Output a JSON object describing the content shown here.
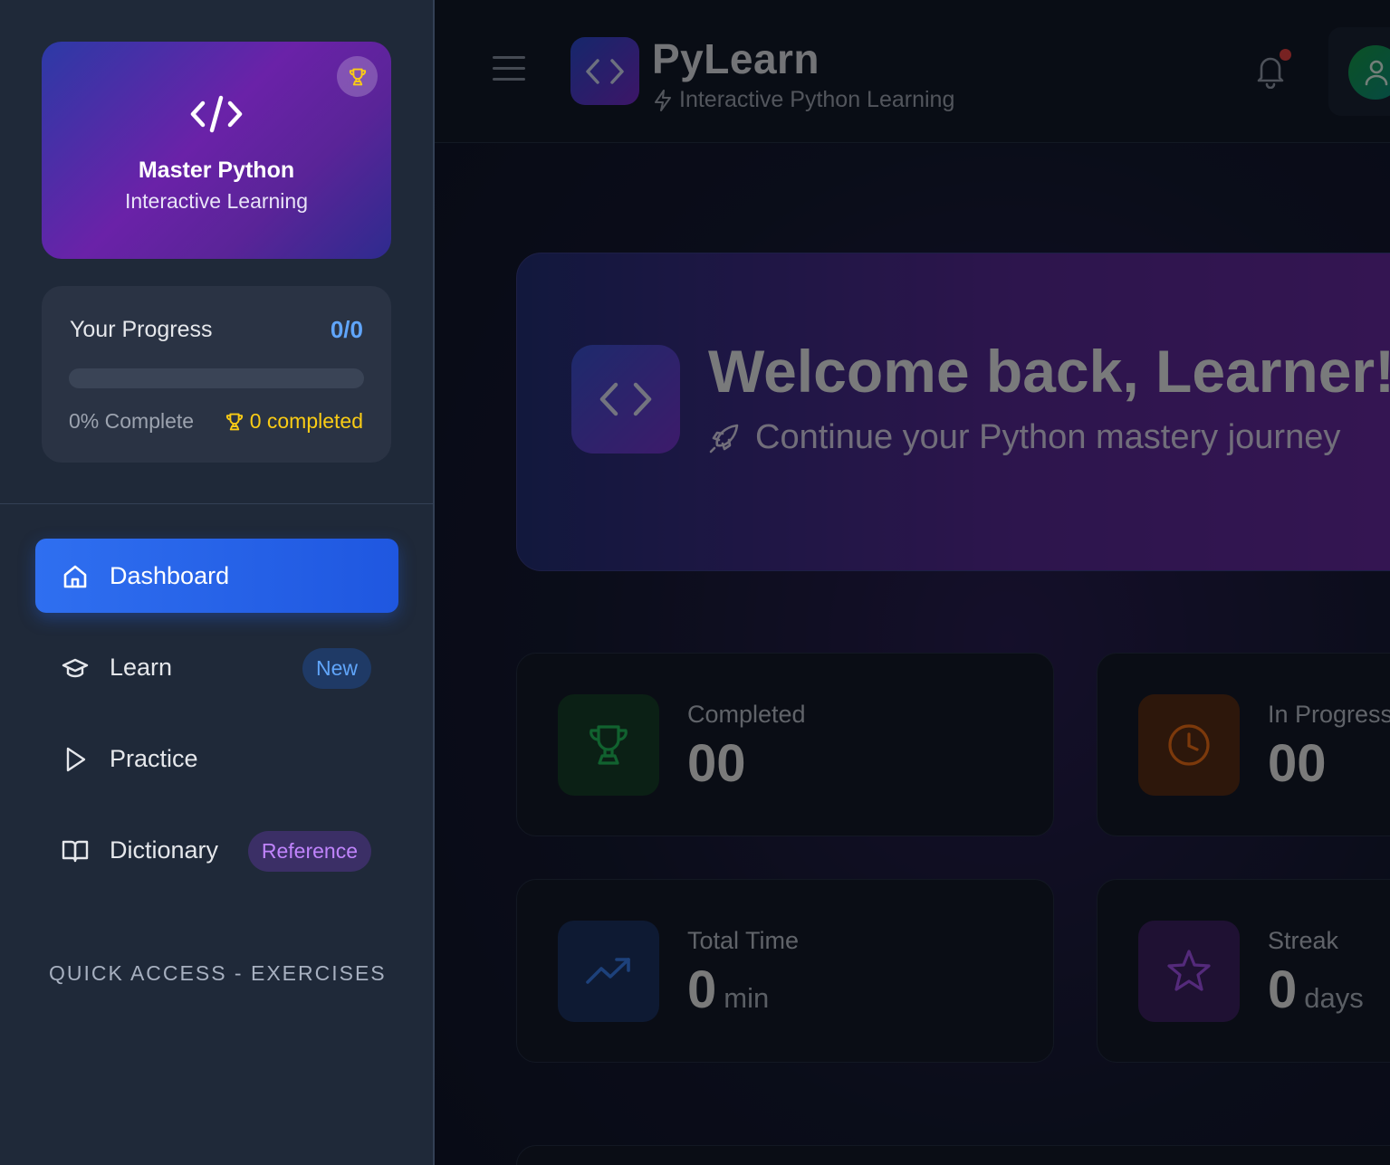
{
  "app": {
    "title": "PyLearn",
    "subtitle": "Interactive Python Learning"
  },
  "sidebar": {
    "hero": {
      "title": "Master Python",
      "subtitle": "Interactive Learning"
    },
    "progress": {
      "title": "Your Progress",
      "count": "0/0",
      "percent_text": "0% Complete",
      "percent_value": 0,
      "completed_text": "0 completed"
    },
    "nav": [
      {
        "label": "Dashboard",
        "icon": "home-icon",
        "active": true
      },
      {
        "label": "Learn",
        "icon": "graduation-cap-icon",
        "badge": "New"
      },
      {
        "label": "Practice",
        "icon": "play-icon"
      },
      {
        "label": "Dictionary",
        "icon": "book-icon",
        "badge": "Reference"
      }
    ],
    "section_label": "QUICK ACCESS - EXERCISES"
  },
  "welcome": {
    "title": "Welcome back, Learner!",
    "subtitle": "Continue your Python mastery journey"
  },
  "stats": [
    {
      "label": "Completed",
      "value": "00",
      "unit": "",
      "icon": "trophy-icon",
      "color": "#22c55e"
    },
    {
      "label": "In Progress",
      "value": "00",
      "unit": "",
      "icon": "clock-icon",
      "color": "#f97316"
    },
    {
      "label": "Total Time",
      "value": "0",
      "unit": "min",
      "icon": "trending-up-icon",
      "color": "#3b82f6"
    },
    {
      "label": "Streak",
      "value": "0",
      "unit": "days",
      "icon": "star-icon",
      "color": "#a855f7"
    }
  ],
  "colors": {
    "accent": "#2563eb",
    "progress": "#60a5fa",
    "completed": "#facc15",
    "notification": "#ef4444"
  }
}
